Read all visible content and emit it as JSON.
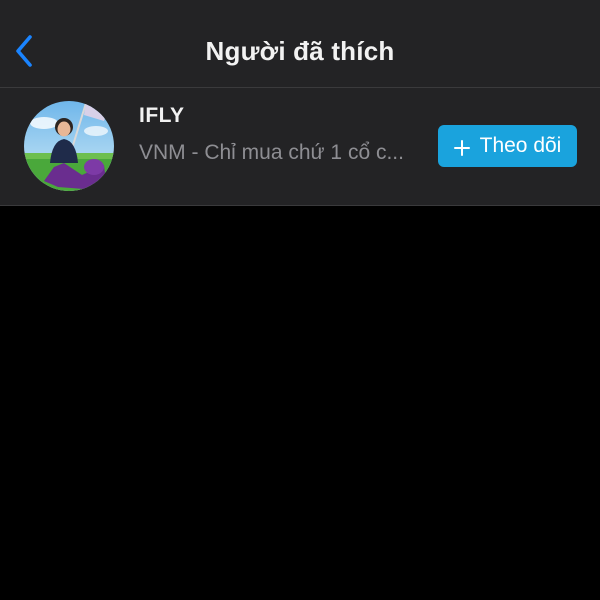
{
  "header": {
    "title": "Người đã thích",
    "back_icon": "chevron-left-icon"
  },
  "likers": [
    {
      "username": "IFLY",
      "bio": "VNM - Chỉ mua chứ 1 cổ c...",
      "avatar_icon": "user-avatar",
      "follow_label": "Theo dõi",
      "follow_icon": "plus-icon"
    }
  ],
  "colors": {
    "background": "#000000",
    "surface": "#232325",
    "divider": "#3a3a3c",
    "accent_back": "#1a84ff",
    "follow_button": "#1aa3dd",
    "text_primary": "#f2f2f2",
    "text_secondary": "#8e8e93"
  }
}
